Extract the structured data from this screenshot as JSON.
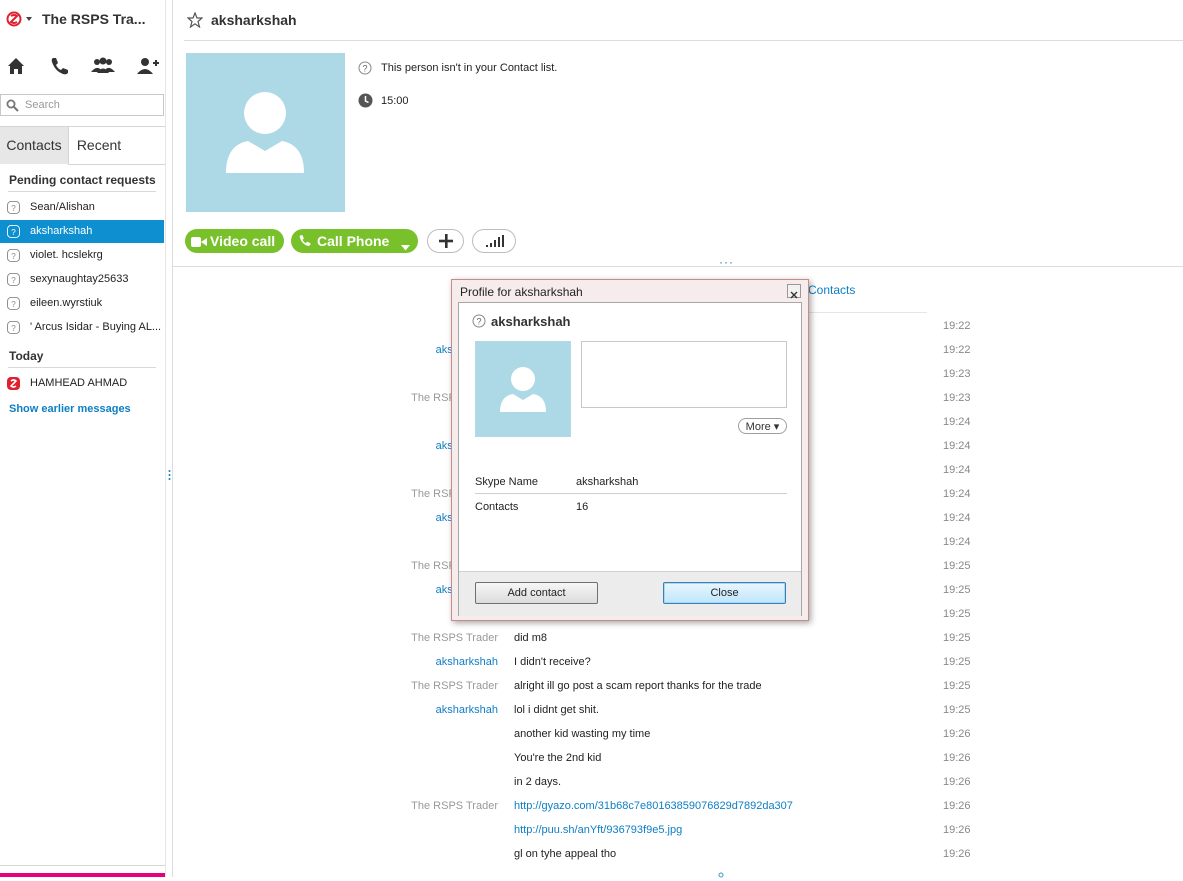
{
  "app": {
    "title": "The RSPS Tra..."
  },
  "search": {
    "placeholder": "Search"
  },
  "tabs": [
    {
      "label": "Contacts"
    },
    {
      "label": "Recent"
    }
  ],
  "sidebar": {
    "pending_header": "Pending contact requests",
    "pending": [
      {
        "label": "Sean/Alishan",
        "selected": false
      },
      {
        "label": "aksharkshah",
        "selected": true
      },
      {
        "label": "violet. hcslekrg",
        "selected": false
      },
      {
        "label": "sexynaughtay25633",
        "selected": false
      },
      {
        "label": "eileen.wyrstiuk",
        "selected": false
      },
      {
        "label": "' Arcus Isidar - Buying AL...",
        "selected": false
      }
    ],
    "today_header": "Today",
    "today": [
      {
        "label": "HAMHEAD AHMAD"
      }
    ],
    "show_earlier": "Show earlier messages"
  },
  "conversation": {
    "name": "aksharkshah",
    "not_in_contacts": "This person isn't in your Contact list.",
    "local_time": "15:00",
    "video_call_label": "Video call",
    "call_phone_label": "Call Phone",
    "contacts_link": "Contacts"
  },
  "messages": [
    {
      "sender": "",
      "text": "",
      "time": "19:22"
    },
    {
      "sender": "aksharkshah",
      "who": "me",
      "text": "",
      "time": "19:22"
    },
    {
      "sender": "",
      "text": "",
      "time": "19:23"
    },
    {
      "sender": "The RSPS Trader",
      "who": "other",
      "text": "",
      "time": "19:23"
    },
    {
      "sender": "",
      "text": "",
      "time": "19:24"
    },
    {
      "sender": "aksharkshah",
      "who": "me",
      "text": "",
      "time": "19:24"
    },
    {
      "sender": "",
      "text": "",
      "time": "19:24"
    },
    {
      "sender": "The RSPS Trader",
      "who": "other",
      "text": "",
      "time": "19:24"
    },
    {
      "sender": "aksharkshah",
      "who": "me",
      "text": "",
      "time": "19:24"
    },
    {
      "sender": "",
      "text": "",
      "time": "19:24"
    },
    {
      "sender": "The RSPS Trader",
      "who": "other",
      "text": "",
      "time": "19:25"
    },
    {
      "sender": "aksharkshah",
      "who": "me",
      "text": "",
      "time": "19:25"
    },
    {
      "sender": "",
      "text": "",
      "time": "19:25"
    },
    {
      "sender": "The RSPS Trader",
      "who": "other",
      "text": "did m8",
      "time": "19:25"
    },
    {
      "sender": "aksharkshah",
      "who": "me",
      "text": "I didn't receive?",
      "time": "19:25"
    },
    {
      "sender": "The RSPS Trader",
      "who": "other",
      "text": "alright ill go post a scam report thanks for the trade",
      "time": "19:25"
    },
    {
      "sender": "aksharkshah",
      "who": "me",
      "text": "lol i didnt get shit.",
      "time": "19:25"
    },
    {
      "sender": "",
      "text": "another kid wasting my time",
      "time": "19:26"
    },
    {
      "sender": "",
      "text": "You're the 2nd kid",
      "time": "19:26"
    },
    {
      "sender": "",
      "text": "in 2 days.",
      "time": "19:26"
    },
    {
      "sender": "The RSPS Trader",
      "who": "other",
      "text": "http://gyazo.com/31b68c7e80163859076829d7892da307",
      "time": "19:26",
      "link": true
    },
    {
      "sender": "",
      "text": "http://puu.sh/anYft/936793f9e5.jpg",
      "time": "19:26",
      "link": true
    },
    {
      "sender": "",
      "text": "gl on tyhe appeal tho",
      "time": "19:26"
    }
  ],
  "dialog": {
    "title": "Profile for aksharkshah",
    "name": "aksharkshah",
    "more_label": "More ▾",
    "skype_name_label": "Skype Name",
    "skype_name_value": "aksharkshah",
    "contacts_label": "Contacts",
    "contacts_value": "16",
    "add_contact_label": "Add contact",
    "close_label": "Close"
  },
  "colors": {
    "accent": "#0d8fd0",
    "green": "#79c12a",
    "avatar": "#add8e6",
    "brand": "#e6007a"
  }
}
